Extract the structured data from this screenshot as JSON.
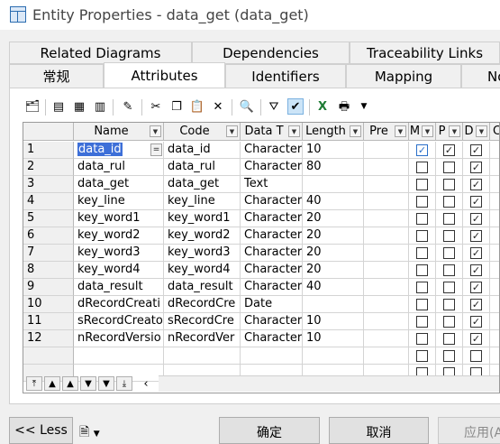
{
  "window": {
    "title": "Entity Properties - data_get (data_get)"
  },
  "tabs_row1": [
    "Related Diagrams",
    "Dependencies",
    "Traceability Links"
  ],
  "tabs_row2": [
    "常规",
    "Attributes",
    "Identifiers",
    "Mapping",
    "No"
  ],
  "selected_tab": "Attributes",
  "toolbar": {
    "icons": [
      "properties-icon",
      "insert-row-icon",
      "add-row-icon",
      "add-attributes-icon",
      "rules-icon",
      "cut-icon",
      "copy-icon",
      "paste-icon",
      "delete-icon",
      "find-icon",
      "filter-icon",
      "customize-columns-icon",
      "export-excel-icon",
      "print-icon",
      "dropdown-arrow-icon"
    ]
  },
  "grid": {
    "columns": [
      "Name",
      "Code",
      "Data T",
      "Length",
      "Pre",
      "M",
      "P",
      "D",
      "C"
    ],
    "rows": [
      {
        "num": "1",
        "name": "data_id",
        "code": "data_id",
        "type": "Character",
        "length": "10",
        "pre": "",
        "m": true,
        "p": true,
        "d": true
      },
      {
        "num": "2",
        "name": "data_rul",
        "code": "data_rul",
        "type": "Character",
        "length": "80",
        "pre": "",
        "m": false,
        "p": false,
        "d": true
      },
      {
        "num": "3",
        "name": "data_get",
        "code": "data_get",
        "type": "Text",
        "length": "",
        "pre": "",
        "m": false,
        "p": false,
        "d": true
      },
      {
        "num": "4",
        "name": "key_line",
        "code": "key_line",
        "type": "Character",
        "length": "40",
        "pre": "",
        "m": false,
        "p": false,
        "d": true
      },
      {
        "num": "5",
        "name": "key_word1",
        "code": "key_word1",
        "type": "Character",
        "length": "20",
        "pre": "",
        "m": false,
        "p": false,
        "d": true
      },
      {
        "num": "6",
        "name": "key_word2",
        "code": "key_word2",
        "type": "Character",
        "length": "20",
        "pre": "",
        "m": false,
        "p": false,
        "d": true
      },
      {
        "num": "7",
        "name": "key_word3",
        "code": "key_word3",
        "type": "Character",
        "length": "20",
        "pre": "",
        "m": false,
        "p": false,
        "d": true
      },
      {
        "num": "8",
        "name": "key_word4",
        "code": "key_word4",
        "type": "Character",
        "length": "20",
        "pre": "",
        "m": false,
        "p": false,
        "d": true
      },
      {
        "num": "9",
        "name": "data_result",
        "code": "data_result",
        "type": "Character",
        "length": "40",
        "pre": "",
        "m": false,
        "p": false,
        "d": true
      },
      {
        "num": "10",
        "name": "dRecordCreati",
        "code": "dRecordCre",
        "type": "Date",
        "length": "",
        "pre": "",
        "m": false,
        "p": false,
        "d": true
      },
      {
        "num": "11",
        "name": "sRecordCreato",
        "code": "sRecordCre",
        "type": "Character",
        "length": "10",
        "pre": "",
        "m": false,
        "p": false,
        "d": true
      },
      {
        "num": "12",
        "name": "nRecordVersio",
        "code": "nRecordVer",
        "type": "Character",
        "length": "10",
        "pre": "",
        "m": false,
        "p": false,
        "d": true
      }
    ],
    "empty_rows": 2,
    "nav": [
      "⤒",
      "▲",
      "▲",
      "▼",
      "▼",
      "⤓"
    ]
  },
  "buttons": {
    "less": "<< Less",
    "ok": "确定",
    "cancel": "取消",
    "apply": "应用(A"
  }
}
